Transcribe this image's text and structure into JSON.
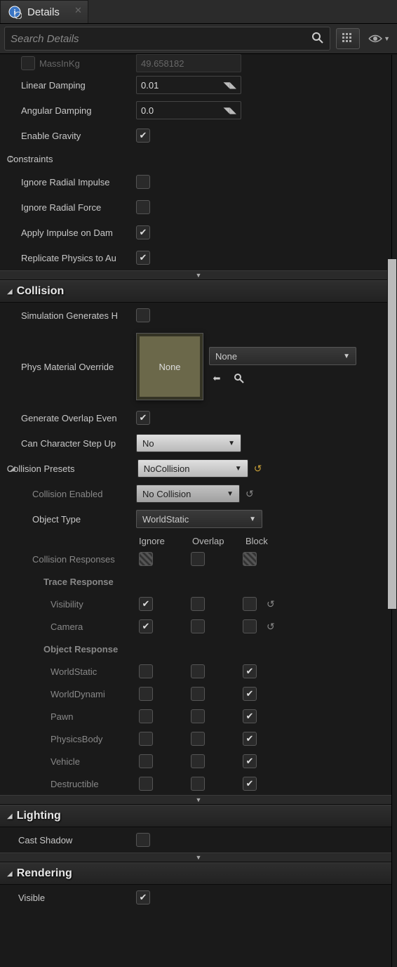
{
  "tab": {
    "title": "Details"
  },
  "search": {
    "placeholder": "Search Details"
  },
  "physics": {
    "massInKg": {
      "label": "MassInKg",
      "value": "49.658182"
    },
    "linearDamping": {
      "label": "Linear Damping",
      "value": "0.01"
    },
    "angularDamping": {
      "label": "Angular Damping",
      "value": "0.0"
    },
    "enableGravity": {
      "label": "Enable Gravity"
    },
    "constraints": {
      "label": "Constraints"
    },
    "ignoreRadialImpulse": {
      "label": "Ignore Radial Impulse"
    },
    "ignoreRadialForce": {
      "label": "Ignore Radial Force"
    },
    "applyImpulseOnDamage": {
      "label": "Apply Impulse on Dam"
    },
    "replicatePhysics": {
      "label": "Replicate Physics to Au"
    }
  },
  "collision": {
    "header": "Collision",
    "simGenHits": {
      "label": "Simulation Generates H"
    },
    "physMatOverride": {
      "label": "Phys Material Override",
      "thumb": "None",
      "dropdown": "None"
    },
    "genOverlap": {
      "label": "Generate Overlap Even"
    },
    "canStepUp": {
      "label": "Can Character Step Up",
      "value": "No"
    },
    "presets": {
      "label": "Collision Presets",
      "value": "NoCollision"
    },
    "collisionEnabled": {
      "label": "Collision Enabled",
      "value": "No Collision"
    },
    "objectType": {
      "label": "Object Type",
      "value": "WorldStatic"
    },
    "responseCols": {
      "ignore": "Ignore",
      "overlap": "Overlap",
      "block": "Block"
    },
    "collisionResponses": "Collision Responses",
    "traceResponse": "Trace Response",
    "objectResponse": "Object Response",
    "rows": {
      "visibility": "Visibility",
      "camera": "Camera",
      "worldStatic": "WorldStatic",
      "worldDynamic": "WorldDynami",
      "pawn": "Pawn",
      "physicsBody": "PhysicsBody",
      "vehicle": "Vehicle",
      "destructible": "Destructible"
    }
  },
  "lighting": {
    "header": "Lighting",
    "castShadow": {
      "label": "Cast Shadow"
    }
  },
  "rendering": {
    "header": "Rendering",
    "visible": {
      "label": "Visible"
    }
  }
}
